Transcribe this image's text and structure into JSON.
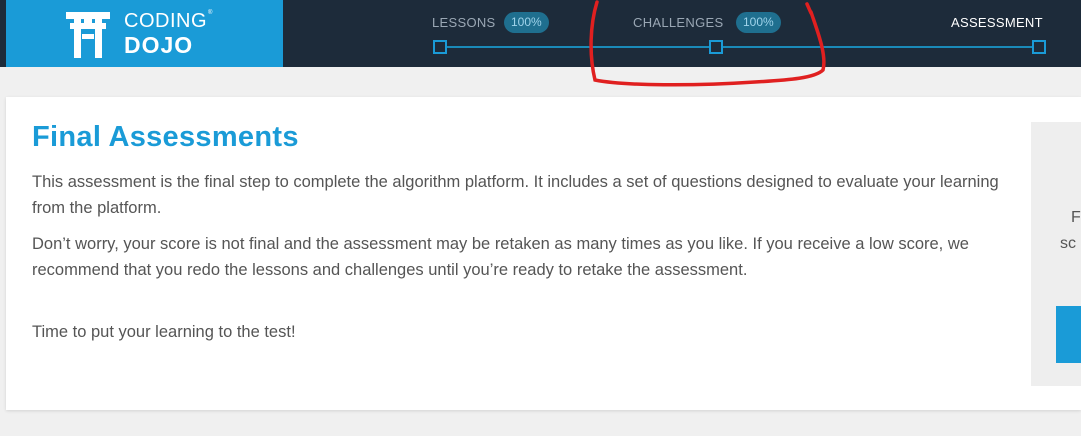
{
  "header": {
    "logo_top": "CODING",
    "logo_trademark": "®",
    "logo_bottom": "DOJO"
  },
  "progress": {
    "steps": [
      {
        "label": "LESSONS",
        "percent": "100%"
      },
      {
        "label": "CHALLENGES",
        "percent": "100%"
      },
      {
        "label": "ASSESSMENT"
      }
    ]
  },
  "main": {
    "title": "Final Assessments",
    "paragraphs": [
      "This assessment is the final step to complete the algorithm platform. It includes a set of questions designed to evaluate your learning from the platform.",
      "Don’t worry, your score is not final and the assessment may be retaken as many times as you like. If you receive a low score, we recommend that you redo the lessons and challenges until you’re ready to retake the assessment.",
      "Time to put your learning to the test!"
    ]
  },
  "side_panel": {
    "text_line1": "F",
    "text_line2": "sc"
  },
  "colors": {
    "brand_blue": "#1a9bd7",
    "header_bg": "#1d2b3a",
    "annotation_red": "#e02020"
  }
}
